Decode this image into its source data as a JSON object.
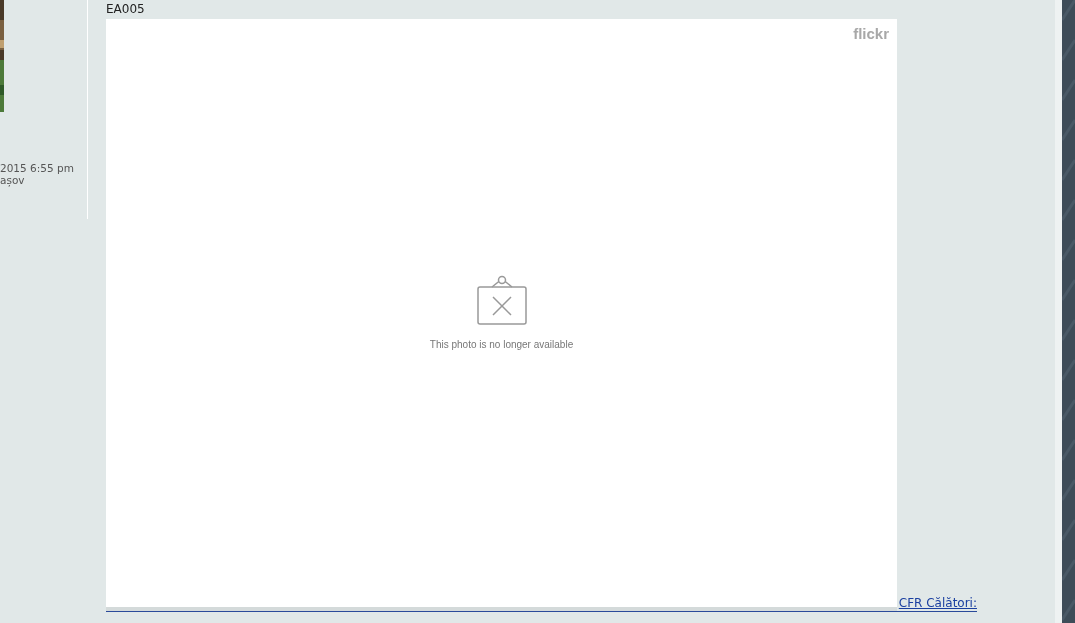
{
  "sidebar": {
    "post_date": "2015 6:55 pm",
    "location": "așov"
  },
  "post": {
    "title": "EA005",
    "embed": {
      "brand": "flickr",
      "message": "This photo is no longer available"
    },
    "signature_link": "CFR Călători:"
  }
}
